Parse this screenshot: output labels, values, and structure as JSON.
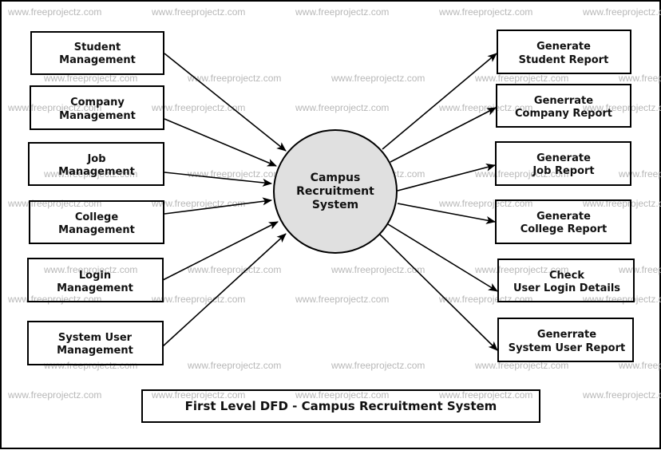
{
  "watermark": "www.freeprojectz.com",
  "process": {
    "lines": [
      "Campus",
      "Recruitment",
      "System"
    ],
    "fill": "#e0e0e0"
  },
  "inputs": [
    {
      "id": "student-management",
      "lines": [
        "Student",
        "Management"
      ]
    },
    {
      "id": "company-management",
      "lines": [
        "Company",
        "Management"
      ]
    },
    {
      "id": "job-management",
      "lines": [
        "Job",
        "Management"
      ]
    },
    {
      "id": "college-management",
      "lines": [
        "College",
        "Management"
      ]
    },
    {
      "id": "login-management",
      "lines": [
        "Login",
        "Management"
      ]
    },
    {
      "id": "system-user-management",
      "lines": [
        "System User",
        "Management"
      ]
    }
  ],
  "outputs": [
    {
      "id": "generate-student-report",
      "lines": [
        "Generate",
        "Student Report"
      ]
    },
    {
      "id": "generrate-company-report",
      "lines": [
        "Generrate",
        "Company Report"
      ]
    },
    {
      "id": "generate-job-report",
      "lines": [
        "Generate",
        "Job Report"
      ]
    },
    {
      "id": "generate-college-report",
      "lines": [
        "Generate",
        "College Report"
      ]
    },
    {
      "id": "check-user-login-details",
      "lines": [
        "Check",
        "User Login Details"
      ]
    },
    {
      "id": "generrate-system-user-report",
      "lines": [
        "Generrate",
        "System User Report"
      ]
    }
  ],
  "caption": "First Level DFD - Campus Recruitment System"
}
